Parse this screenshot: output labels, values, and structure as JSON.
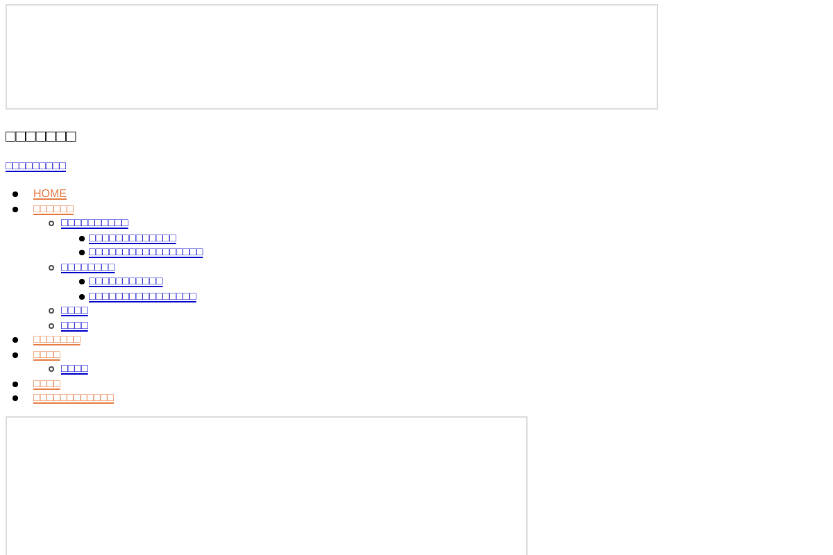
{
  "site_title": "□□□□□□□",
  "tagline_link": "□□□□□□□□□",
  "nav": [
    {
      "label": "HOME"
    },
    {
      "label": "□□□□□□",
      "children": [
        {
          "label": "□□□□□□□□□□",
          "children": [
            {
              "label": "□□□□□□□□□□□□□"
            },
            {
              "label": "□□□□□□□□□□□□□□□□□"
            }
          ]
        },
        {
          "label": "□□□□□□□□",
          "children": [
            {
              "label": "□□□□□□□□□□□"
            },
            {
              "label": "□□□□□□□□□□□□□□□□"
            }
          ]
        },
        {
          "label": "□□□□"
        },
        {
          "label": "□□□□"
        }
      ]
    },
    {
      "label": "□□□□□□□"
    },
    {
      "label": "□□□□",
      "children": [
        {
          "label": "□□□□"
        }
      ]
    },
    {
      "label": "□□□□"
    },
    {
      "label": "□□□□□□□□□□□□"
    }
  ]
}
